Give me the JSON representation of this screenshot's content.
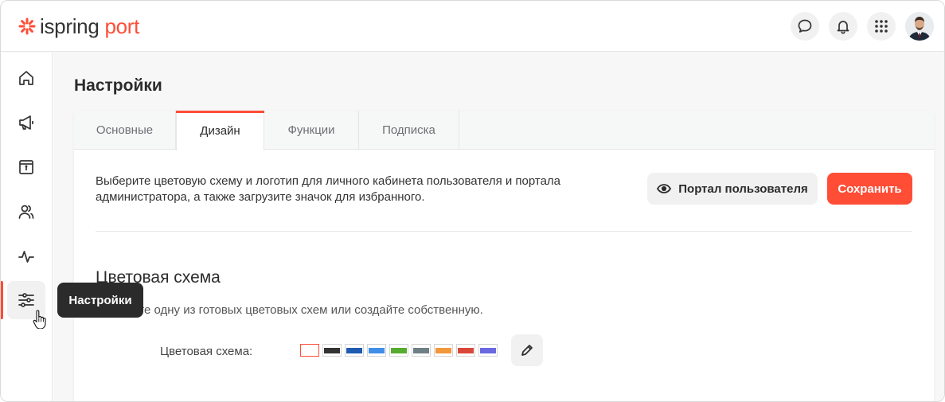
{
  "header": {
    "logo_part1": "ispring",
    "logo_part2": "port",
    "brand_color": "#ff4d36",
    "icons": [
      "chat-icon",
      "bell-icon",
      "apps-grid-icon"
    ]
  },
  "sidebar": {
    "items": [
      {
        "name": "home",
        "icon": "home-icon"
      },
      {
        "name": "announcements",
        "icon": "megaphone-icon"
      },
      {
        "name": "catalog",
        "icon": "archive-icon"
      },
      {
        "name": "users",
        "icon": "users-icon"
      },
      {
        "name": "activity",
        "icon": "pulse-icon"
      },
      {
        "name": "settings",
        "icon": "sliders-icon",
        "active": true
      }
    ],
    "tooltip": "Настройки"
  },
  "page": {
    "title": "Настройки",
    "tabs": [
      {
        "label": "Основные"
      },
      {
        "label": "Дизайн",
        "active": true
      },
      {
        "label": "Функции"
      },
      {
        "label": "Подписка"
      }
    ],
    "description": "Выберите цветовую схему и логотип для личного кабинета пользователя и портала администратора, а также загрузите значок для избранного.",
    "portal_button": "Портал пользователя",
    "save_button": "Сохранить",
    "section_title": "Цветовая схема",
    "section_subtitle": "Выберите одну из готовых цветовых схем или создайте собственную.",
    "section_subtitle_visible": "те одну из готовых цветовых схем или создайте собственную.",
    "scheme_label": "Цветовая схема:",
    "swatches": [
      "#ffffff",
      "#333333",
      "#1f5bb0",
      "#3f8fe8",
      "#56ac2f",
      "#6f7f86",
      "#f2973a",
      "#d9473a",
      "#6b68e0"
    ],
    "selected_swatch": 0
  }
}
